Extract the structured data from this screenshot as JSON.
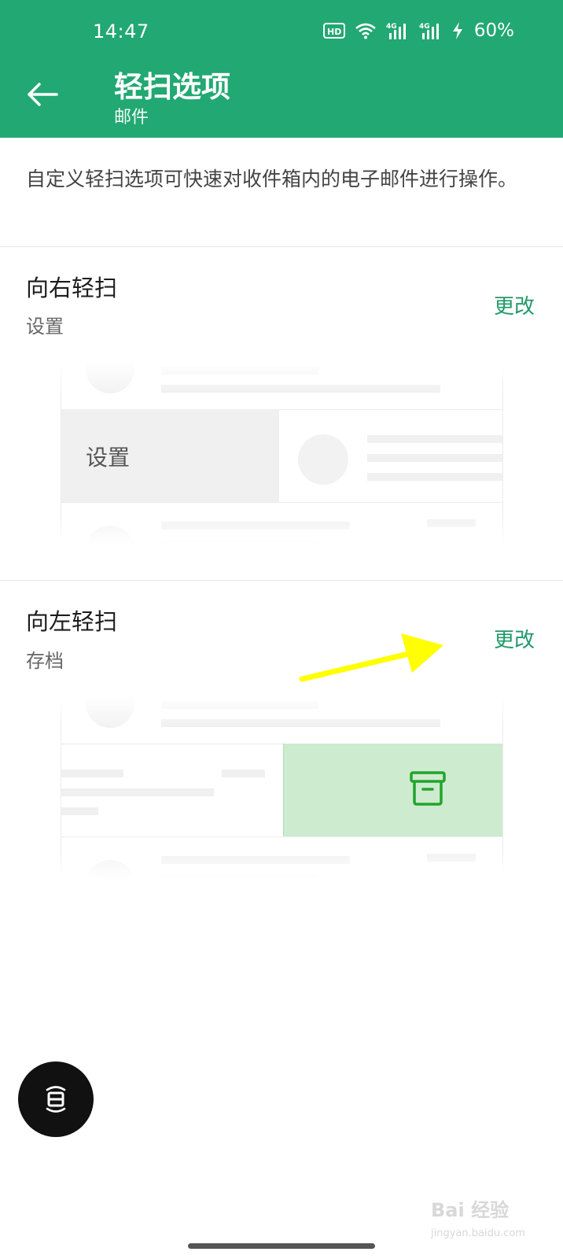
{
  "status_bar": {
    "time": "14:47",
    "hd_label": "HD",
    "net1": "4G",
    "net2": "4G",
    "battery": "60%"
  },
  "header": {
    "title": "轻扫选项",
    "subtitle": "邮件",
    "background_color": "#22a872"
  },
  "description": "自定义轻扫选项可快速对收件箱内的电子邮件进行操作。",
  "swipe_right": {
    "title": "向右轻扫",
    "action": "设置",
    "change_label": "更改",
    "illustration_label": "设置"
  },
  "swipe_left": {
    "title": "向左轻扫",
    "action": "存档",
    "change_label": "更改",
    "illustration_icon": "archive-icon",
    "illustration_color": "#cdebcf"
  },
  "watermark": {
    "text": "Bai 经验",
    "url": "jingyan.baidu.com"
  },
  "accent_color": "#1f9a6a",
  "annotation_arrow_color": "#ffff00"
}
